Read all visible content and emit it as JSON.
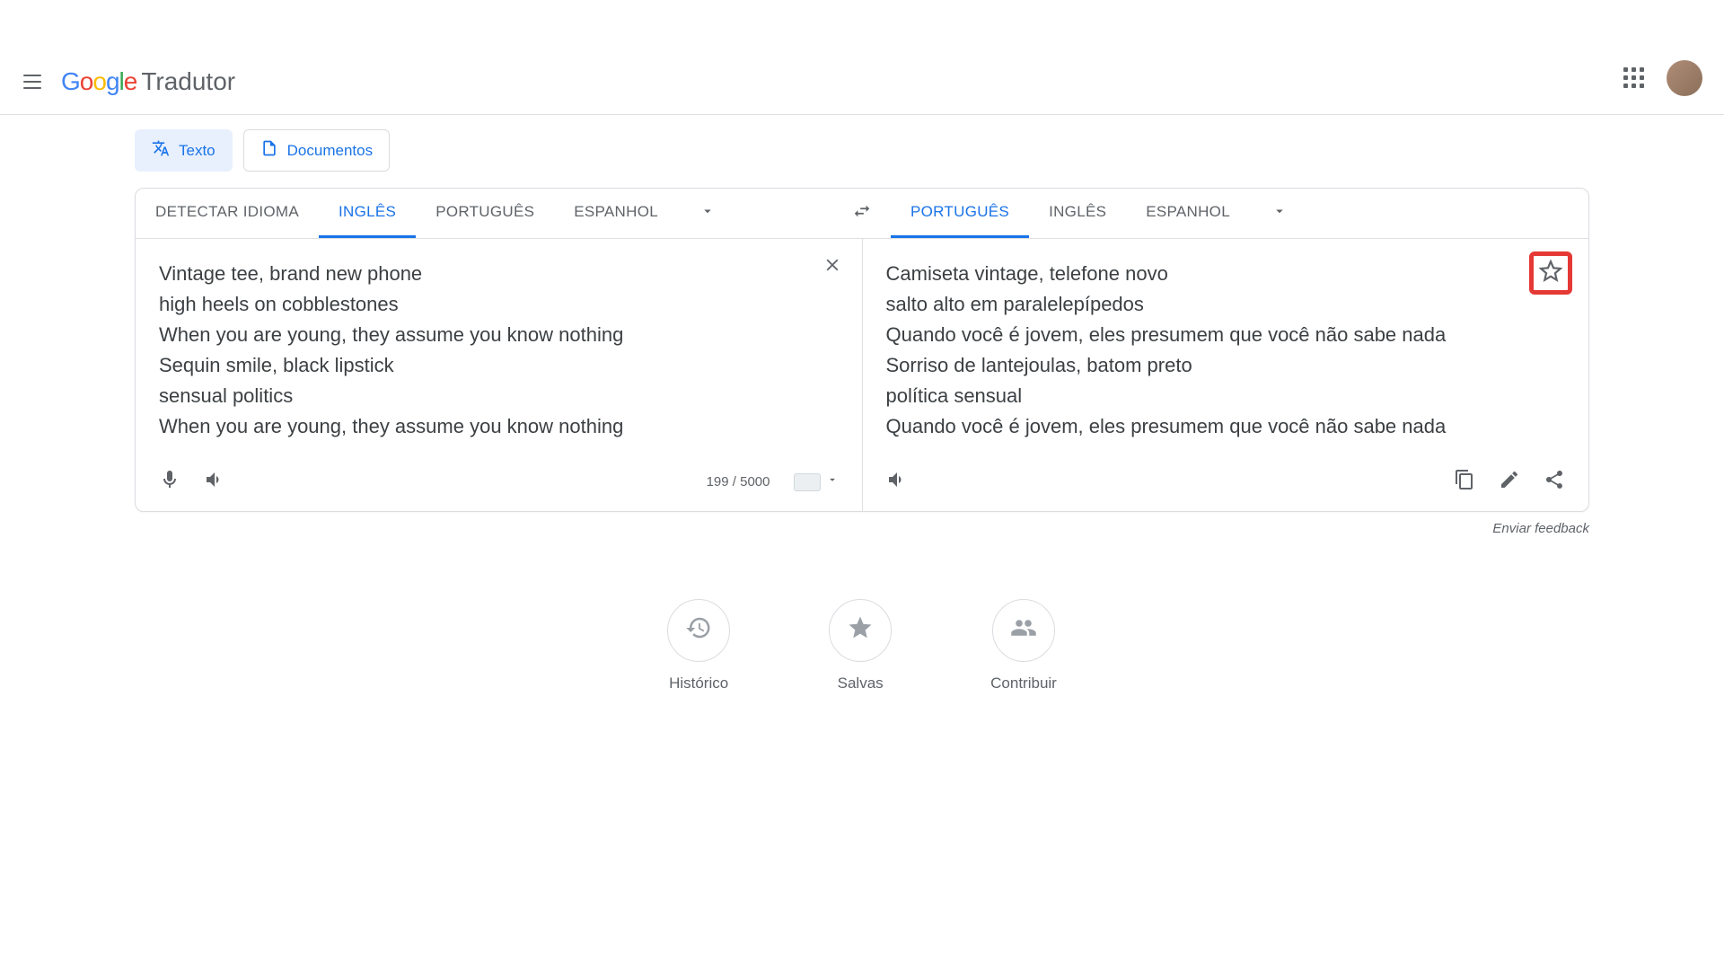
{
  "header": {
    "product_name": "Tradutor"
  },
  "modes": {
    "text": "Texto",
    "documents": "Documentos"
  },
  "lang_bar": {
    "source": {
      "detect": "DETECTAR IDIOMA",
      "tabs": [
        "INGLÊS",
        "PORTUGUÊS",
        "ESPANHOL"
      ],
      "active_index": 0
    },
    "target": {
      "tabs": [
        "PORTUGUÊS",
        "INGLÊS",
        "ESPANHOL"
      ],
      "active_index": 0
    }
  },
  "source": {
    "text": "Vintage tee, brand new phone\nhigh heels on cobblestones\nWhen you are young, they assume you know nothing\nSequin smile, black lipstick\nsensual politics\nWhen you are young, they assume you know nothing",
    "char_count": "199 / 5000"
  },
  "target": {
    "text": "Camiseta vintage, telefone novo\nsalto alto em paralelepípedos\nQuando você é jovem, eles presumem que você não sabe nada\nSorriso de lantejoulas, batom preto\npolítica sensual\nQuando você é jovem, eles presumem que você não sabe nada"
  },
  "footer": {
    "feedback": "Enviar feedback"
  },
  "quick_links": {
    "history": "Histórico",
    "saved": "Salvas",
    "contribute": "Contribuir"
  }
}
